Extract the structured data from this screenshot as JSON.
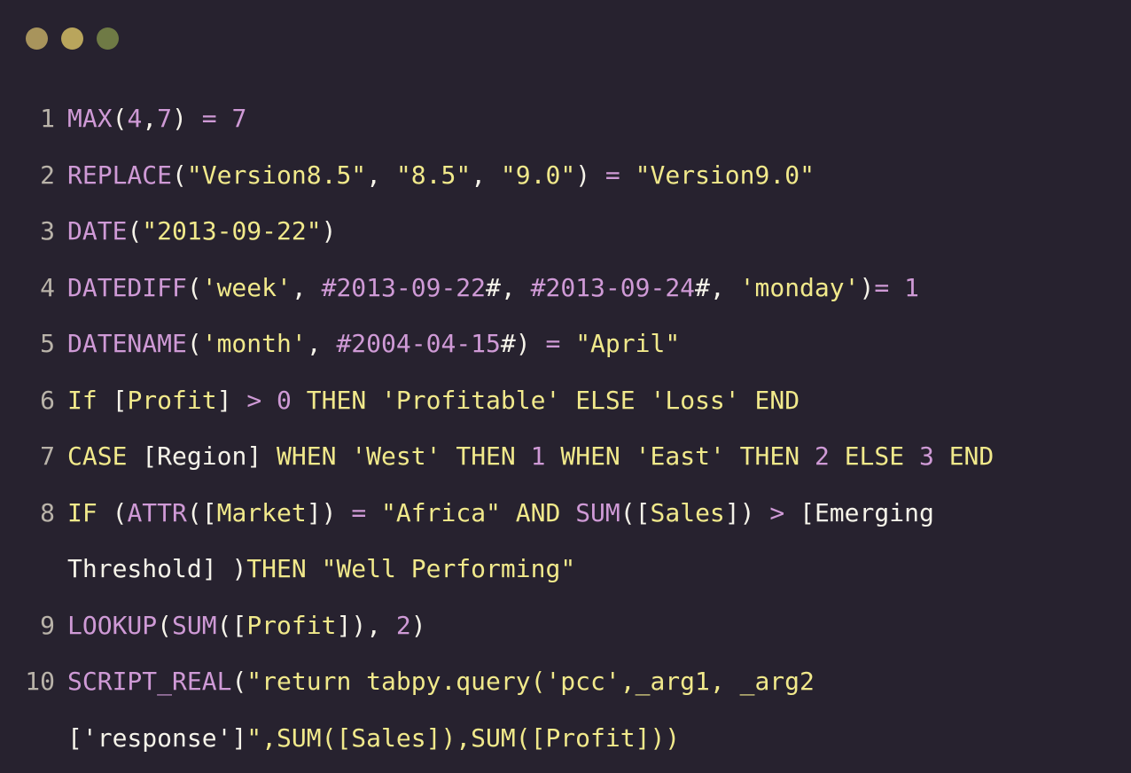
{
  "window": {
    "title_dots": [
      "close",
      "minimize",
      "maximize"
    ]
  },
  "code": {
    "lines": [
      {
        "number": "1",
        "text": "MAX(4,7) = 7"
      },
      {
        "number": "2",
        "text": "REPLACE(\"Version8.5\", \"8.5\", \"9.0\") = \"Version9.0\""
      },
      {
        "number": "3",
        "text": "DATE(\"2013-09-22\")"
      },
      {
        "number": "4",
        "text": "DATEDIFF('week', #2013-09-22#, #2013-09-24#, 'monday')= 1"
      },
      {
        "number": "5",
        "text": "DATENAME('month', #2004-04-15#) = \"April\""
      },
      {
        "number": "6",
        "text": "If [Profit] > 0 THEN 'Profitable' ELSE 'Loss' END"
      },
      {
        "number": "7",
        "text": "CASE [Region] WHEN 'West' THEN 1 WHEN 'East' THEN 2 ELSE 3 END"
      },
      {
        "number": "8",
        "text": "IF (ATTR([Market]) = \"Africa\" AND SUM([Sales]) > [Emerging",
        "continuation": "Threshold] )THEN \"Well Performing\""
      },
      {
        "number": "9",
        "text": "LOOKUP(SUM([Profit]), 2)"
      },
      {
        "number": "10",
        "text": "SCRIPT_REAL(\"return tabpy.query('pcc',_arg1, _arg2",
        "continuation": "['response']\",SUM([Sales]),SUM([Profit]))"
      }
    ]
  },
  "colors": {
    "background": "#27222f",
    "function": "#cf9ad6",
    "string": "#f1e98b",
    "plain": "#f5f3e9",
    "line_number": "#b9b3a9"
  }
}
